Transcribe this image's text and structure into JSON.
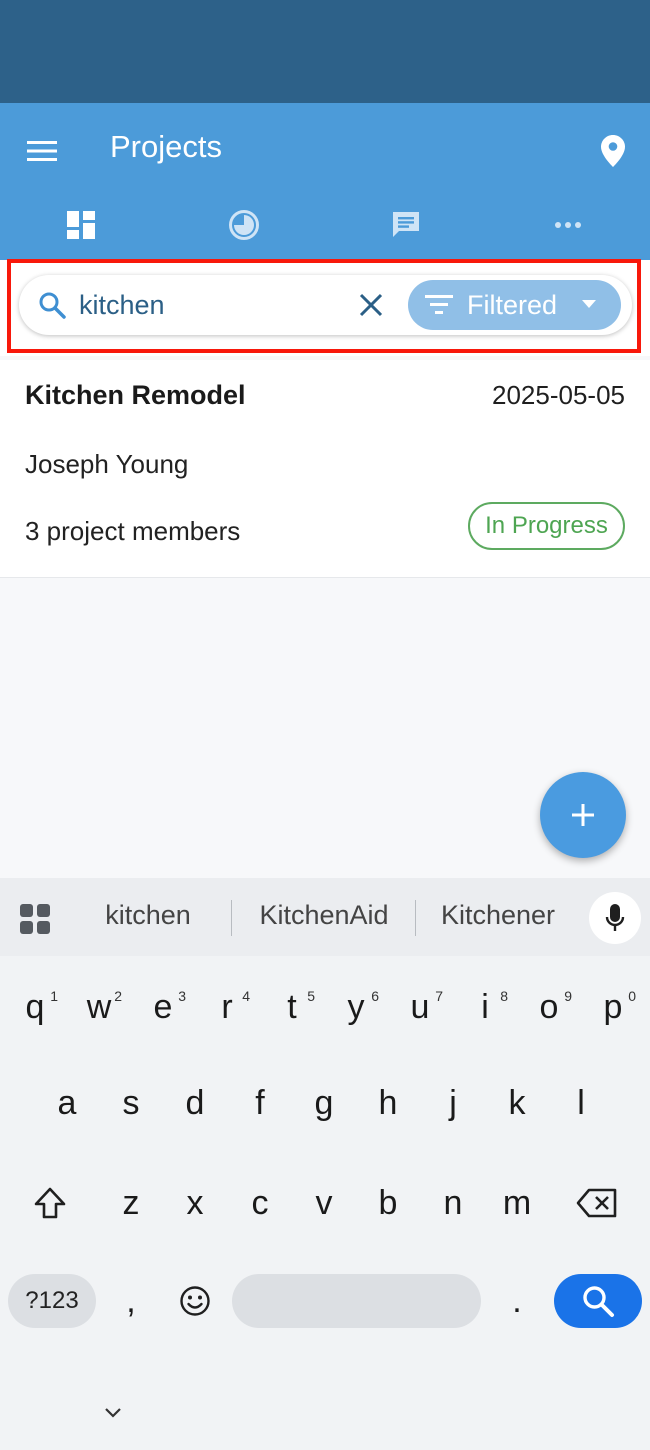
{
  "app_bar": {
    "title": "Projects",
    "tabs": [
      "dashboard",
      "timeline",
      "messages",
      "more"
    ]
  },
  "search": {
    "value": "kitchen",
    "placeholder": "",
    "filter_label": "Filtered"
  },
  "projects": [
    {
      "name": "Kitchen Remodel",
      "date": "2025-05-05",
      "owner": "Joseph Young",
      "members": "3 project members",
      "status": "In Progress"
    }
  ],
  "keyboard": {
    "suggestions": [
      "kitchen",
      "KitchenAid",
      "Kitchener"
    ],
    "row1": [
      "q",
      "w",
      "e",
      "r",
      "t",
      "y",
      "u",
      "i",
      "o",
      "p"
    ],
    "row1_hints": [
      "1",
      "2",
      "3",
      "4",
      "5",
      "6",
      "7",
      "8",
      "9",
      "0"
    ],
    "row2": [
      "a",
      "s",
      "d",
      "f",
      "g",
      "h",
      "j",
      "k",
      "l"
    ],
    "row3": [
      "z",
      "x",
      "c",
      "v",
      "b",
      "n",
      "m"
    ],
    "symbols_label": "?123",
    "comma": ",",
    "period": "."
  },
  "colors": {
    "status_bar": "#2d6189",
    "app_bar": "#4c9bd9",
    "accent": "#4a9be0",
    "filter_chip": "#90bfe7",
    "highlight": "#f8180b",
    "status_in_progress": "#4ea552",
    "keyboard_search": "#1a73e8"
  }
}
